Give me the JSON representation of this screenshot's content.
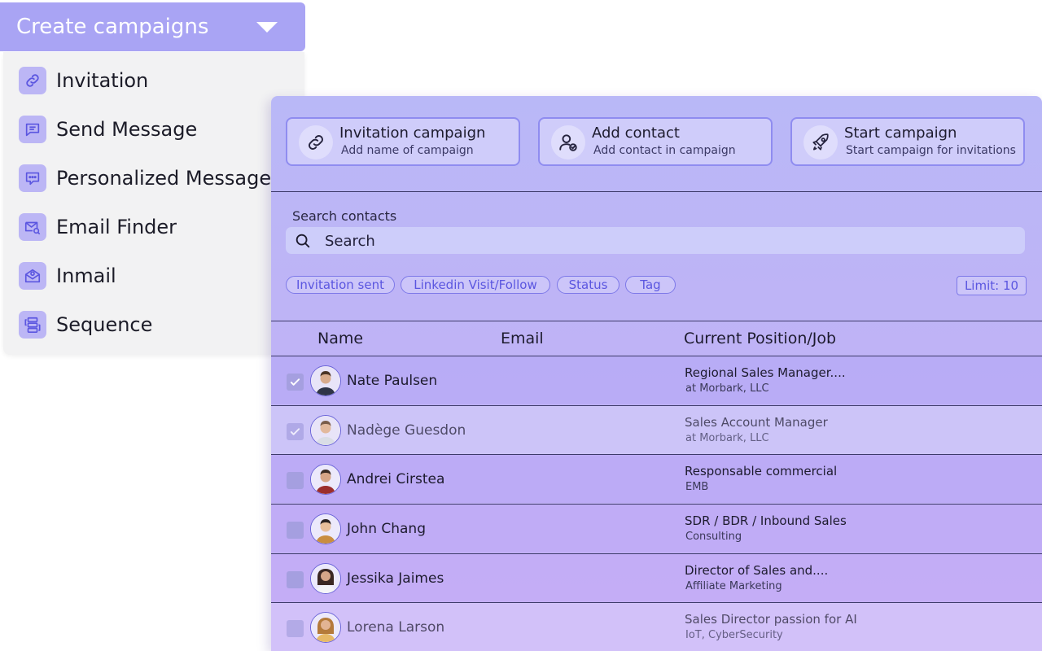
{
  "dropdown": {
    "title": "Create campaigns",
    "items": [
      {
        "label": "Invitation",
        "icon": "link-icon"
      },
      {
        "label": "Send Message",
        "icon": "message-icon"
      },
      {
        "label": "Personalized Message",
        "icon": "chat-dots-icon"
      },
      {
        "label": "Email Finder",
        "icon": "mail-search-icon"
      },
      {
        "label": "Inmail",
        "icon": "inmail-icon"
      },
      {
        "label": "Sequence",
        "icon": "sequence-icon"
      }
    ]
  },
  "steps": [
    {
      "title": "Invitation campaign",
      "subtitle": "Add name of campaign",
      "icon": "link-icon"
    },
    {
      "title": "Add contact",
      "subtitle": "Add contact in campaign",
      "icon": "user-check-icon"
    },
    {
      "title": "Start campaign",
      "subtitle": "Start campaign for invitations",
      "icon": "rocket-icon"
    }
  ],
  "search": {
    "label": "Search contacts",
    "placeholder": "Search"
  },
  "filters": [
    "Invitation sent",
    "Linkedin Visit/Follow",
    "Status",
    "Tag"
  ],
  "limit": "Limit: 10",
  "table": {
    "columns": [
      "Name",
      "Email",
      "Current Position/Job"
    ],
    "rows": [
      {
        "name": "Nate Paulsen",
        "email": "",
        "title": "Regional Sales Manager....",
        "company": "at Morbark, LLC",
        "checked": true
      },
      {
        "name": "Nadège Guesdon",
        "email": "",
        "title": "Sales Account Manager",
        "company": "at Morbark, LLC",
        "checked": true
      },
      {
        "name": "Andrei Cirstea",
        "email": "",
        "title": "Responsable commercial",
        "company": "EMB",
        "checked": false
      },
      {
        "name": "John Chang",
        "email": "",
        "title": "SDR / BDR / Inbound Sales",
        "company": "Consulting",
        "checked": false
      },
      {
        "name": "Jessika Jaimes",
        "email": "",
        "title": "Director of Sales and....",
        "company": "Affiliate Marketing",
        "checked": false
      },
      {
        "name": "Lorena Larson",
        "email": "",
        "title": "Sales Director passion for AI",
        "company": "IoT, CyberSecurity",
        "checked": false
      }
    ]
  },
  "colors": {
    "accent": "#a9a4f4",
    "chip_text": "#5b56e0",
    "panel_top": "#b9b8f7",
    "panel_bottom": "#c6b4f5"
  }
}
